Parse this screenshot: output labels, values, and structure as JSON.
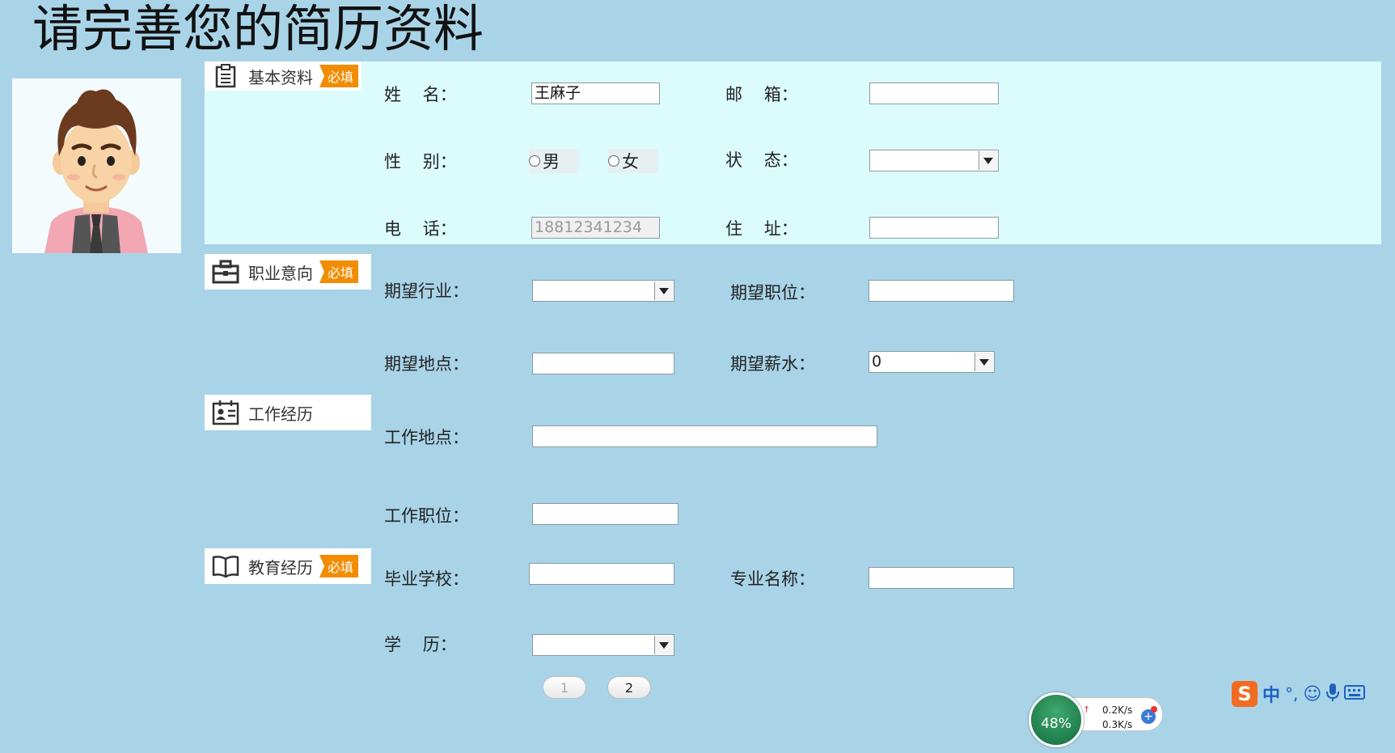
{
  "page": {
    "title": "请完善您的简历资料"
  },
  "sections": {
    "basic": {
      "label": "基本资料",
      "required_tag": "必填"
    },
    "career": {
      "label": "职业意向",
      "required_tag": "必填"
    },
    "work": {
      "label": "工作经历"
    },
    "education": {
      "label": "教育经历",
      "required_tag": "必填"
    }
  },
  "basic": {
    "name_label": "姓    名：",
    "name_value": "王麻子",
    "email_label": "邮    箱：",
    "email_value": "",
    "gender_label": "性    别：",
    "gender_options": [
      "男",
      "女"
    ],
    "status_label": "状    态：",
    "status_value": "",
    "phone_label": "电    话：",
    "phone_value": "18812341234",
    "address_label": "住    址：",
    "address_value": ""
  },
  "career": {
    "industry_label": "期望行业：",
    "industry_value": "",
    "position_label": "期望职位：",
    "position_value": "",
    "location_label": "期望地点：",
    "location_value": "",
    "salary_label": "期望薪水：",
    "salary_value": "0"
  },
  "work": {
    "location_label": "工作地点：",
    "location_value": "",
    "position_label": "工作职位：",
    "position_value": ""
  },
  "education": {
    "school_label": "毕业学校：",
    "school_value": "",
    "major_label": "专业名称：",
    "major_value": "",
    "degree_label": "学    历：",
    "degree_value": ""
  },
  "pager": {
    "pages": [
      "1",
      "2"
    ],
    "current": "2"
  },
  "tray": {
    "speed_percent": "48%",
    "upload_speed": "0.2K/s",
    "download_speed": "0.3K/s",
    "ime_mode": "中"
  },
  "colors": {
    "background": "#a9d4e8",
    "basic_band": "#dcfcfc",
    "required_tag": "#f28c00"
  }
}
